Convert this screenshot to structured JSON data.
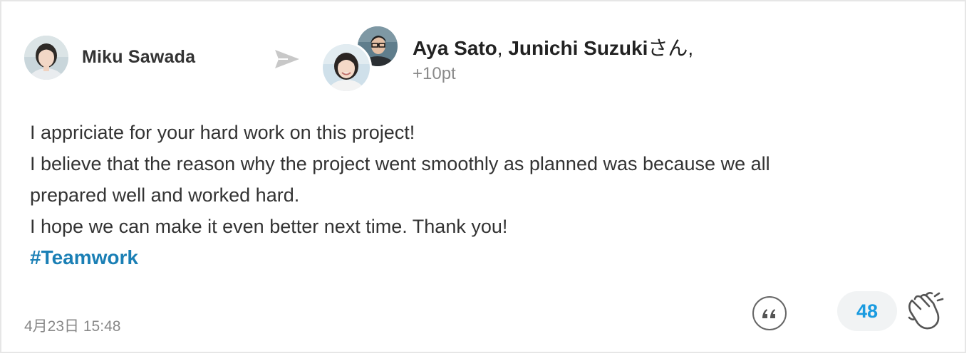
{
  "post": {
    "sender": {
      "name": "Miku Sawada",
      "avatar": "avatar-miku-sawada"
    },
    "send_icon": "send-arrow-icon",
    "recipients": {
      "name1": "Aya Sato",
      "separator": ", ",
      "name2": "Junichi Suzuki",
      "suffix": "さん,",
      "avatars": [
        "avatar-junichi-suzuki",
        "avatar-aya-sato"
      ]
    },
    "points": "+10pt",
    "message": {
      "lines": [
        "I appriciate for your hard work on this project!",
        "I believe that the reason why the project went smoothly as planned was because we all",
        "prepared well and worked hard.",
        "I hope we can make it even better next time. Thank you!"
      ],
      "hashtag": "#Teamwork"
    },
    "timestamp": "4月23日 15:48",
    "actions": {
      "quote_icon": "quote-icon",
      "clap_count": "48",
      "clap_icon": "clap-hands-icon"
    },
    "colors": {
      "hashtag": "#1a7fb5",
      "clap_count": "#1a9be0",
      "clap_count_bg": "#f1f3f4"
    }
  }
}
